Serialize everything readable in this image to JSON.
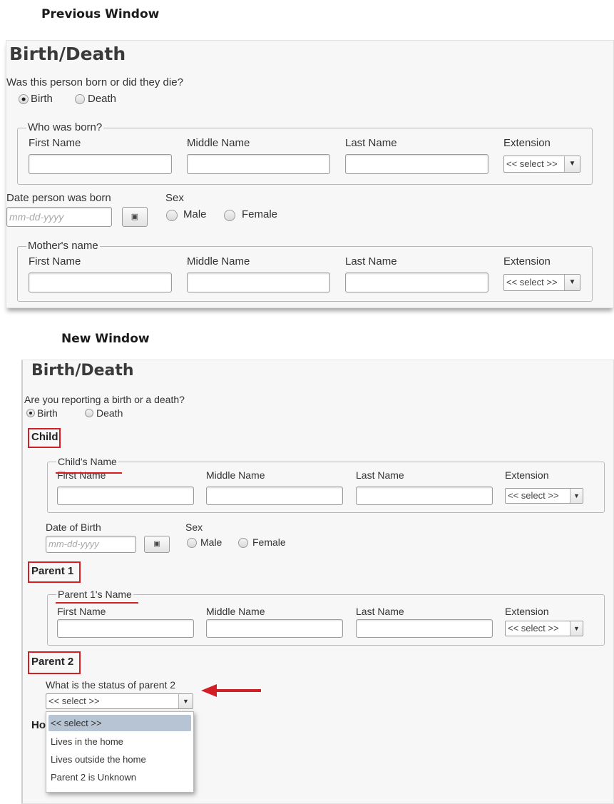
{
  "captions": {
    "previous": "Previous Window",
    "new": "New Window"
  },
  "previous": {
    "title": "Birth/Death",
    "question": "Was this person born or did they die?",
    "radio_birth": "Birth",
    "radio_death": "Death",
    "selected": "Birth",
    "fieldset1_legend": "Who was born?",
    "name_columns": [
      "First Name",
      "Middle Name",
      "Last Name",
      "Extension"
    ],
    "select_value": "<< select >>",
    "dob_label": "Date person was born",
    "date_placeholder": "mm-dd-yyyy",
    "sex_label": "Sex",
    "sex_male": "Male",
    "sex_female": "Female",
    "fieldset2_legend": "Mother's name"
  },
  "new": {
    "title": "Birth/Death",
    "question": "Are you reporting a birth or a death?",
    "radio_birth": "Birth",
    "radio_death": "Death",
    "selected": "Birth",
    "section_child": "Child",
    "child_legend": "Child's Name",
    "name_columns": [
      "First Name",
      "Middle Name",
      "Last Name",
      "Extension"
    ],
    "select_value": "<< select >>",
    "dob_label": "Date of Birth",
    "date_placeholder": "mm-dd-yyyy",
    "sex_label": "Sex",
    "sex_male": "Male",
    "sex_female": "Female",
    "section_parent1": "Parent 1",
    "parent1_legend": "Parent 1's Name",
    "section_parent2": "Parent 2",
    "parent2_question": "What is the status of parent 2",
    "parent2_select_value": "<< select >>",
    "partial_heading": "Ho",
    "parent2_options": [
      "<< select >>",
      "Lives in the home",
      "Lives outside the home",
      "Parent 2 is Unknown"
    ]
  },
  "colors": {
    "highlight_red": "#d21f26",
    "selected_option": "#b7c4d3",
    "panel_bg": "#f7f7f7"
  }
}
